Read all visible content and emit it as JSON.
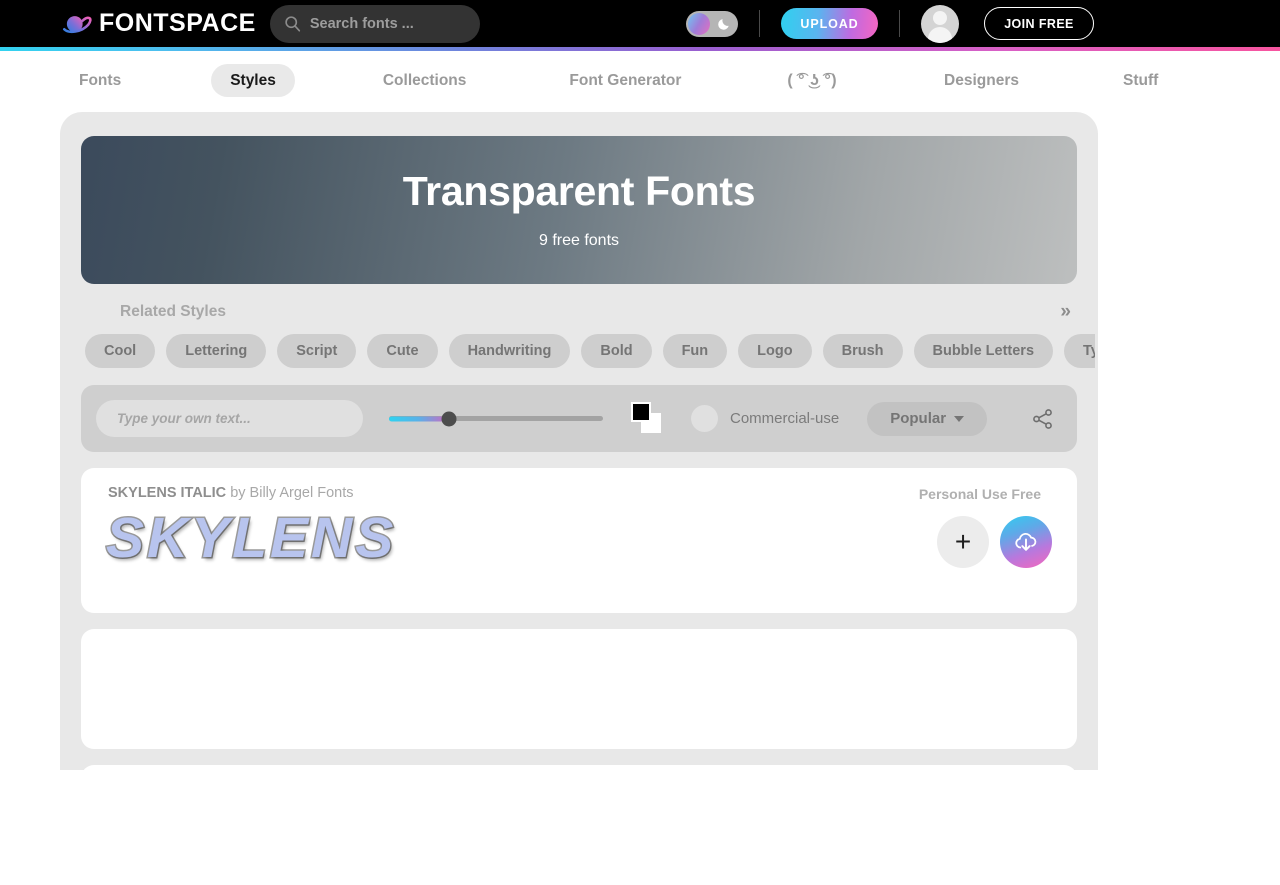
{
  "header": {
    "logo_text": "FONTSPACE",
    "logo_icon": "planet-icon",
    "search": {
      "placeholder": "Search fonts ...",
      "value": "",
      "icon": "search-icon"
    },
    "theme_toggle": {
      "icon": "moon-icon",
      "state": "light"
    },
    "upload_label": "UPLOAD",
    "avatar": "user-avatar",
    "join_label": "JOIN FREE",
    "accent_cyan": "#33d2ef",
    "accent_pink": "#f7559f"
  },
  "nav": {
    "items": [
      {
        "label": "Fonts",
        "active": false
      },
      {
        "label": "Styles",
        "active": true
      },
      {
        "label": "Collections",
        "active": false
      },
      {
        "label": "Font Generator",
        "active": false
      },
      {
        "label": "( ͡° ͜ʖ ͡°)",
        "active": false
      },
      {
        "label": "Designers",
        "active": false
      },
      {
        "label": "Stuff",
        "active": false
      }
    ]
  },
  "hero": {
    "title": "Transparent Fonts",
    "subtitle": "9 free fonts"
  },
  "related": {
    "label": "Related Styles",
    "more_icon": "chevron-double-right-icon",
    "chips": [
      "Cool",
      "Lettering",
      "Script",
      "Cute",
      "Handwriting",
      "Bold",
      "Fun",
      "Logo",
      "Brush",
      "Bubble Letters",
      "Ty"
    ]
  },
  "toolbar": {
    "text_input_placeholder": "Type your own text...",
    "text_input_value": "",
    "size_slider": {
      "value": 28,
      "min": 0,
      "max": 100
    },
    "swatches": {
      "foreground": "#000000",
      "background": "#ffffff"
    },
    "commercial_label": "Commercial-use",
    "commercial_enabled": false,
    "sort_label": "Popular",
    "share_icon": "share-icon"
  },
  "cards": [
    {
      "font_name": "SKYLENS ITALIC",
      "by_label": "by",
      "author": "Billy Argel Fonts",
      "preview_text": "SKYLENS",
      "license": "Personal Use Free",
      "add_icon": "plus-icon",
      "download_icon": "cloud-download-icon",
      "empty": false
    },
    {
      "empty": true
    },
    {
      "empty": true
    }
  ]
}
